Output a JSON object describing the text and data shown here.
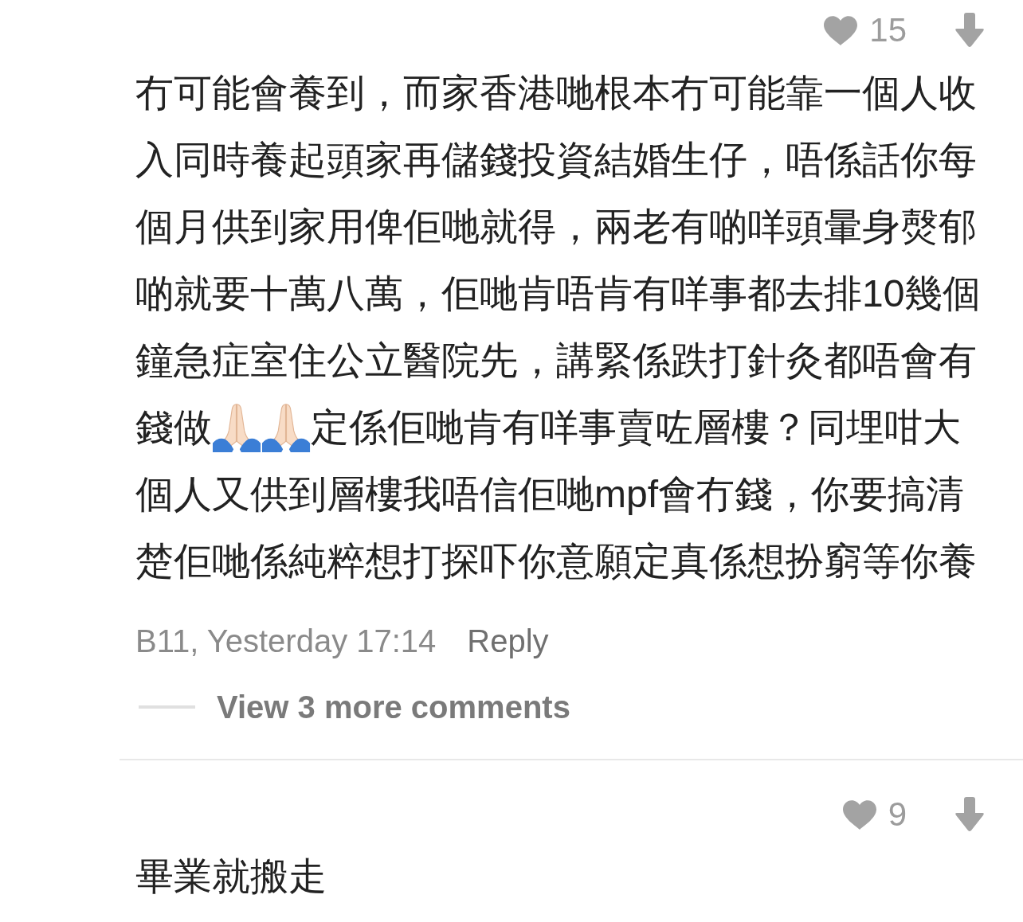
{
  "comments": [
    {
      "likes": "15",
      "body_lines": [
        [
          {
            "kind": "text",
            "text": "冇可能會養到，而家香港哋根本冇可能靠一個人收"
          }
        ],
        [
          {
            "kind": "text",
            "text": "入同時養起頭家再儲錢投資結婚生仔，唔係話你每"
          }
        ],
        [
          {
            "kind": "text",
            "text": "個月供到家用俾佢哋就得，兩老有啲咩頭暈身㷫郁"
          }
        ],
        [
          {
            "kind": "text",
            "text": "啲就要十萬八萬，佢哋肯唔肯有咩事都去排10幾個"
          }
        ],
        [
          {
            "kind": "text",
            "text": "鐘急症室住公立醫院先，講緊係跌打針灸都唔會有"
          }
        ],
        [
          {
            "kind": "text",
            "text": "錢做"
          },
          {
            "kind": "emoji"
          },
          {
            "kind": "emoji"
          },
          {
            "kind": "text",
            "text": "定係佢哋肯有咩事賣咗層樓？同埋咁大"
          }
        ],
        [
          {
            "kind": "text",
            "text": "個人又供到層樓我唔信佢哋mpf會冇錢，你要搞清"
          }
        ],
        [
          {
            "kind": "text",
            "text": "楚佢哋係純粹想打探吓你意願定真係想扮窮等你養"
          }
        ]
      ],
      "meta": "B11, Yesterday 17:14",
      "reply": "Reply",
      "more_replies": "View 3 more comments"
    },
    {
      "likes": "9",
      "body_lines": [
        [
          {
            "kind": "text",
            "text": "畢業就搬走"
          }
        ]
      ]
    }
  ]
}
